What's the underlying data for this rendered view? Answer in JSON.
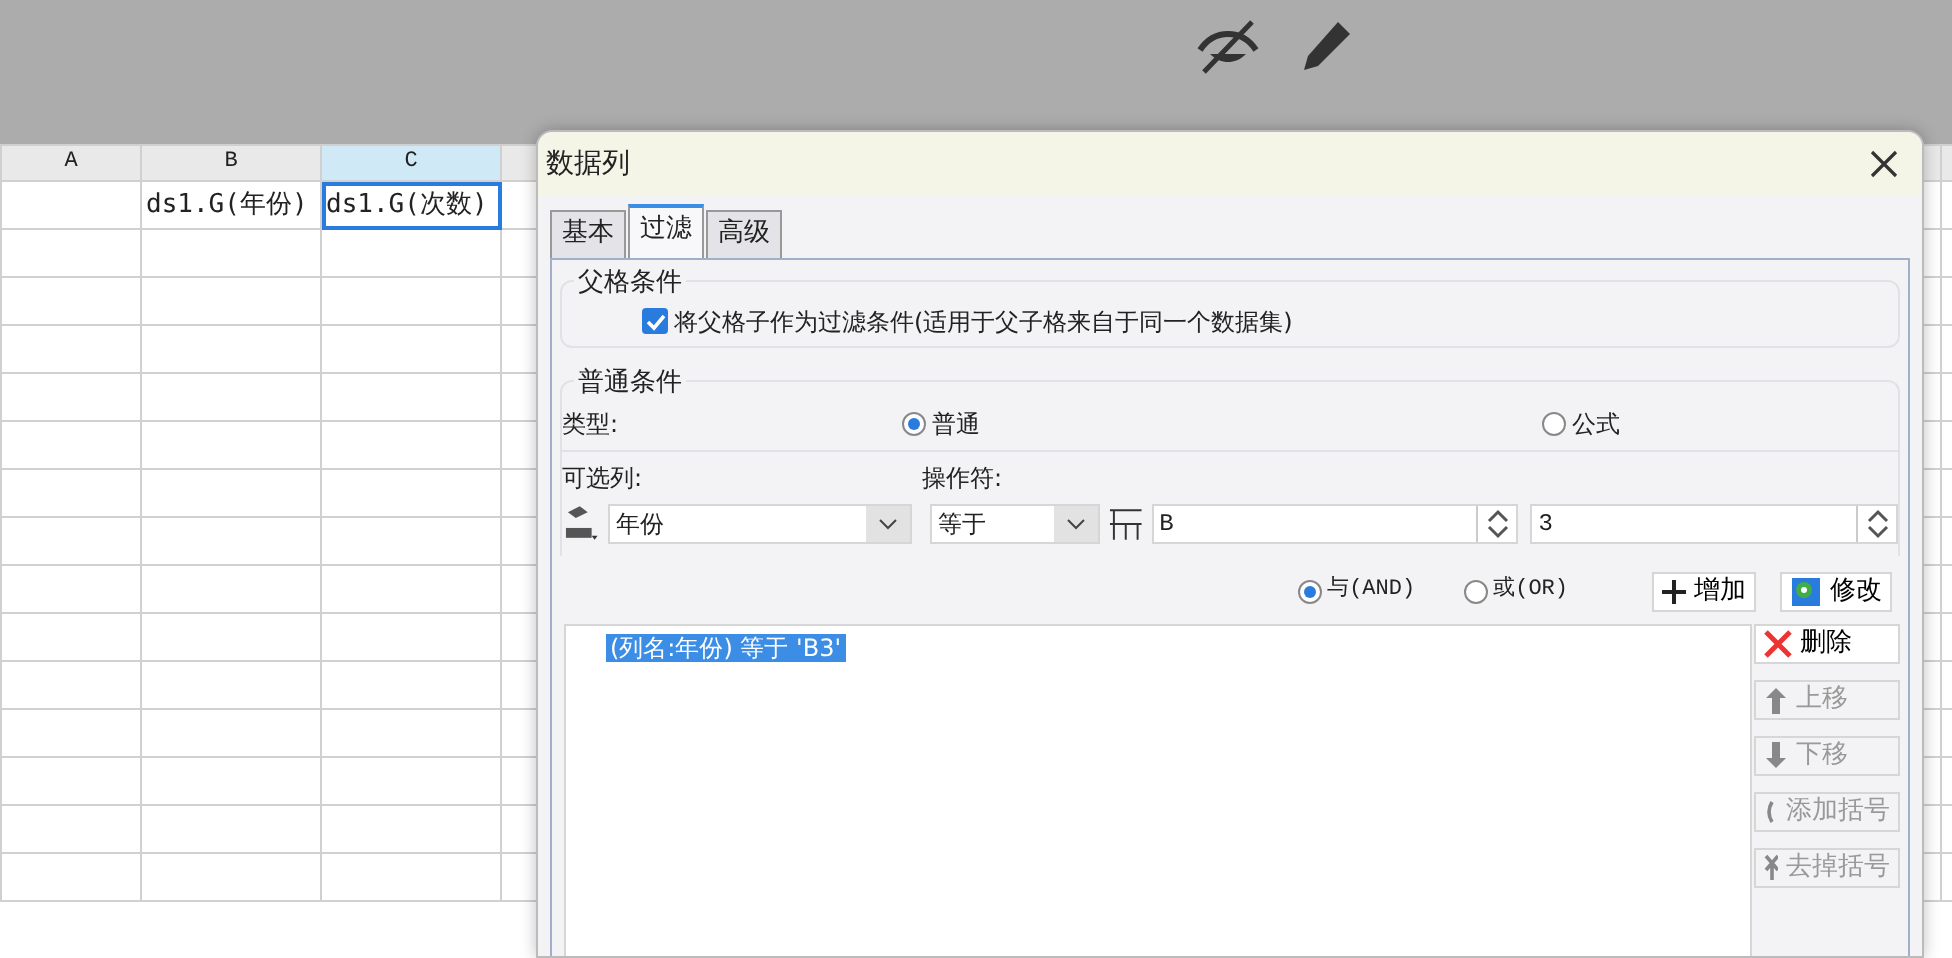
{
  "sheet": {
    "columns": [
      {
        "label": "A",
        "selected": false
      },
      {
        "label": "B",
        "selected": false
      },
      {
        "label": "C",
        "selected": true
      }
    ],
    "rows": [
      {
        "cells": [
          {
            "text": "",
            "selected": false
          },
          {
            "text": "ds1.G(年份)",
            "selected": false
          },
          {
            "text": "ds1.G(次数)",
            "selected": true
          }
        ]
      }
    ]
  },
  "dialog": {
    "title": "数据列",
    "tabs": [
      {
        "label": "基本",
        "selected": false
      },
      {
        "label": "过滤",
        "selected": true
      },
      {
        "label": "高级",
        "selected": false
      }
    ],
    "parent_condition": {
      "legend": "父格条件",
      "checkbox": {
        "label": "将父格子作为过滤条件(适用于父子格来自于同一个数据集)",
        "checked": true
      }
    },
    "normal_condition": {
      "legend": "普通条件",
      "type_label": "类型:",
      "type_options": [
        {
          "label": "普通",
          "selected": true
        },
        {
          "label": "公式",
          "selected": false
        }
      ],
      "column_label": "可选列:",
      "column_value": "年份",
      "operator_label": "操作符:",
      "operator_value": "等于",
      "value_1": "B",
      "value_2": "3"
    },
    "logic_options": [
      {
        "label": "与(AND)",
        "selected": true
      },
      {
        "label": "或(OR)",
        "selected": false
      }
    ],
    "add_button": "增加",
    "modify_button": "修改",
    "conditions": [
      {
        "text": "(列名:年份) 等于 'B3'",
        "selected": true
      }
    ],
    "side_buttons": [
      {
        "kind": "delete",
        "label": "删除",
        "disabled": false
      },
      {
        "kind": "up",
        "label": "上移",
        "disabled": true
      },
      {
        "kind": "down",
        "label": "下移",
        "disabled": true
      },
      {
        "kind": "add-paren",
        "label": "添加括号",
        "disabled": true
      },
      {
        "kind": "remove-paren",
        "label": "去掉括号",
        "disabled": true
      }
    ]
  }
}
